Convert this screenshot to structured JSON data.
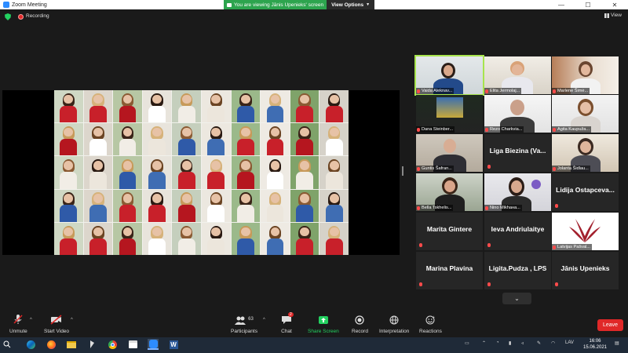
{
  "window": {
    "title": "Zoom Meeting",
    "controls": {
      "minimize": "—",
      "maximize": "☐",
      "close": "✕"
    }
  },
  "banner": {
    "viewing_text": "You are viewing Jānis Upenieks' screen",
    "view_options_label": "View Options"
  },
  "meeting": {
    "recording_label": "Recording",
    "view_label": "View",
    "leave_label": "Leave",
    "accent": "#a7e44d"
  },
  "gallery": {
    "video_tiles": [
      {
        "name": "Vaida Aleknav..."
      },
      {
        "name": "Elita Jermolaj..."
      },
      {
        "name": "Marlene Šimė..."
      },
      {
        "name": "Dana Steinber..."
      },
      {
        "name": "Rezo Charkvia..."
      },
      {
        "name": "Agita Kaupuža..."
      },
      {
        "name": "Guntis Šafran..."
      },
      {
        "name": "Jolanta Šidlau..."
      },
      {
        "name": "Bella Tskhelis..."
      },
      {
        "name": "Nino Mikhaна..."
      },
      {
        "name": "Latvijas Pašval..."
      }
    ],
    "name_tiles": [
      {
        "name": "Liga Biezina (Va..."
      },
      {
        "name": "Lidija Ostapceva..."
      },
      {
        "name": "Marita Gintere"
      },
      {
        "name": "Ieva Andriulaitye"
      },
      {
        "name": "Marina Plavina"
      },
      {
        "name": "Ligita.Pudza , LPS"
      },
      {
        "name": "Jānis Upenieks"
      }
    ],
    "more_icon": "chevron-down-icon"
  },
  "toolbar": {
    "unmute": "Unmute",
    "start_video": "Start Video",
    "participants": "Participants",
    "participants_count": "63",
    "chat": "Chat",
    "chat_badge": "2",
    "share_screen": "Share Screen",
    "record": "Record",
    "interpretation": "Interpretation",
    "reactions": "Reactions"
  },
  "taskbar": {
    "language": "LAV",
    "time": "16:06",
    "date": "15.06.2021",
    "apps": [
      "windows-start-icon",
      "edge-icon",
      "firefox-icon",
      "file-explorer-icon",
      "cursor-app-icon",
      "chrome-icon",
      "store-icon",
      "zoom-icon",
      "word-icon"
    ]
  }
}
